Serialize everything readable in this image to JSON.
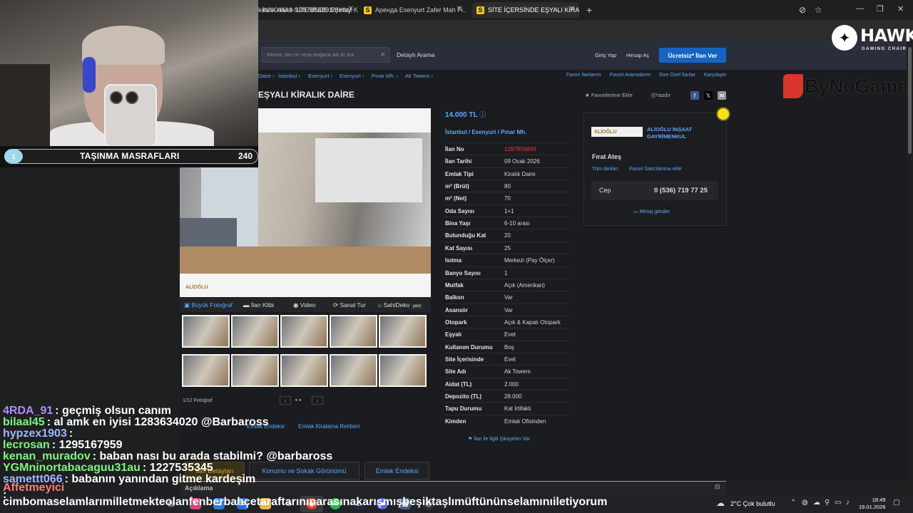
{
  "browser": {
    "tabs": [
      {
        "title": "İNNOVİA3 SİTESİNDE EŞYALI KİRALIK",
        "active": false
      },
      {
        "title": "Аренда Esenyurt Zafer Mah Fi...",
        "active": false
      },
      {
        "title": "SİTE İÇERSİNDE EŞYALI KİRALIK",
        "active": true
      }
    ],
    "url": "kiralik-daire-1287856893/detay"
  },
  "site": {
    "search_placeholder": "Kelime, ilan no veya mağaza adı ile ara",
    "advanced_search": "Detaylı Arama",
    "login": "Giriş Yap",
    "register": "Hesap Aç",
    "post_ad": "Ücretsiz* İlan Ver",
    "breadcrumb": [
      "Daire",
      "İstanbul",
      "Esenyurt",
      "Esenyurt",
      "Pınar Mh.",
      "Ak Towers"
    ],
    "top_links": [
      "Favori İlanlarım",
      "Favori Aramalarım",
      "Size Özel İlanlar",
      "Karşılaştır"
    ],
    "title": "EŞYALI KİRALIK DAİRE",
    "actions": {
      "favorite": "Favorilerime Ekle",
      "print": "Yazdır"
    }
  },
  "photos": {
    "watermark": "ALİOĞLU",
    "tabs": [
      "Büyük Fotoğraf",
      "İlan Klibi",
      "Video",
      "Sanal Tur",
      "SahiDeko"
    ],
    "new_badge": "yeni",
    "count": "1/12 Fotoğraf"
  },
  "listing": {
    "price": "14.000 TL",
    "location": [
      "İstanbul",
      "Esenyurt",
      "Pınar Mh."
    ],
    "details": [
      {
        "k": "İlan No",
        "v": "1287856893"
      },
      {
        "k": "İlan Tarihi",
        "v": "09 Ocak 2026"
      },
      {
        "k": "Emlak Tipi",
        "v": "Kiralık Daire"
      },
      {
        "k": "m² (Brüt)",
        "v": "80"
      },
      {
        "k": "m² (Net)",
        "v": "70"
      },
      {
        "k": "Oda Sayısı",
        "v": "1+1"
      },
      {
        "k": "Bina Yaşı",
        "v": "6-10 arası"
      },
      {
        "k": "Bulunduğu Kat",
        "v": "20"
      },
      {
        "k": "Kat Sayısı",
        "v": "25"
      },
      {
        "k": "Isıtma",
        "v": "Merkezi (Pay Ölçer)"
      },
      {
        "k": "Banyo Sayısı",
        "v": "1"
      },
      {
        "k": "Mutfak",
        "v": "Açık (Amerikan)"
      },
      {
        "k": "Balkon",
        "v": "Var"
      },
      {
        "k": "Asansör",
        "v": "Var"
      },
      {
        "k": "Otopark",
        "v": "Açık & Kapalı Otopark"
      },
      {
        "k": "Eşyalı",
        "v": "Evet"
      },
      {
        "k": "Kullanım Durumu",
        "v": "Boş"
      },
      {
        "k": "Site İçerisinde",
        "v": "Evet"
      },
      {
        "k": "Site Adı",
        "v": "Ak Towers"
      },
      {
        "k": "Aidat (TL)",
        "v": "2.000"
      },
      {
        "k": "Depozito (TL)",
        "v": "28.000"
      },
      {
        "k": "Tapu Durumu",
        "v": "Kat İrtifaklı"
      },
      {
        "k": "Kimden",
        "v": "Emlak Ofisinden"
      }
    ],
    "report": "İlan ile İlgili Şikayetim Var"
  },
  "seller": {
    "logo": "ALİOĞLU",
    "company": "ALİOĞLU İNŞAAT GAYRİMENKUL",
    "person": "Fırat Ateş",
    "all_ads": "Tüm ilanları",
    "fav_seller": "Favori Satıcılarıma ekle",
    "phone_label": "Cep",
    "phone": "0 (536) 719 77 25",
    "message": "Mesaj gönder"
  },
  "lower": {
    "links": [
      "Emlak Endeksi",
      "Emlak Kiralama Rehberi"
    ],
    "tabs": [
      "İlan Detayları",
      "Konumu ve Sokak Görünümü",
      "Emlak Endeksi"
    ],
    "description": "Açıklama"
  },
  "overlay": {
    "goal_index": "1",
    "goal_text": "TAŞINMA MASRAFLARI",
    "goal_value": "240",
    "hawk": "HAWK",
    "hawk_sub": "GAMING CHAIR",
    "bynogame": "ByNoGame",
    "chat": [
      {
        "user": "4RDA_91",
        "color": "#b08cff",
        "msg": ": geçmiş olsun canım"
      },
      {
        "user": "bilaal45",
        "color": "#7ef57e",
        "msg": ": al amk en iyisi 1283634020 @Barbaross"
      },
      {
        "user": "hypzex1903",
        "color": "#9fb7ff",
        "msg": ":"
      },
      {
        "user": "lecrosan",
        "color": "#7ef57e",
        "msg": ": 1295167959"
      },
      {
        "user": "kenan_muradov",
        "color": "#7ef57e",
        "msg": ": baban nası bu arada stabilmi? @barbaross"
      },
      {
        "user": "YGMninortabacaguu31au",
        "color": "#7ef57e",
        "msg": ": 1227535345"
      },
      {
        "user": "samettt066",
        "color": "#9fb7ff",
        "msg": ": babanın yanından gitme kardeşim"
      },
      {
        "user": "Affetmeyici",
        "color": "#ff7a7a",
        "msg": ": cimbomaselamlarımilletmekteolanfenberbahçetaraftarınınarasınakarışmışbeşiktaşlımüftününselamınıiletiyorum"
      }
    ]
  },
  "taskbar": {
    "weather": "2°C  Çok bulutlu",
    "time": "18:49",
    "date": "19.01.2026"
  },
  "colors": {
    "accent": "#5aa9ff",
    "cta": "#1565c0",
    "ilan_no": "#e53935",
    "tab_active": "#c9a33a"
  }
}
